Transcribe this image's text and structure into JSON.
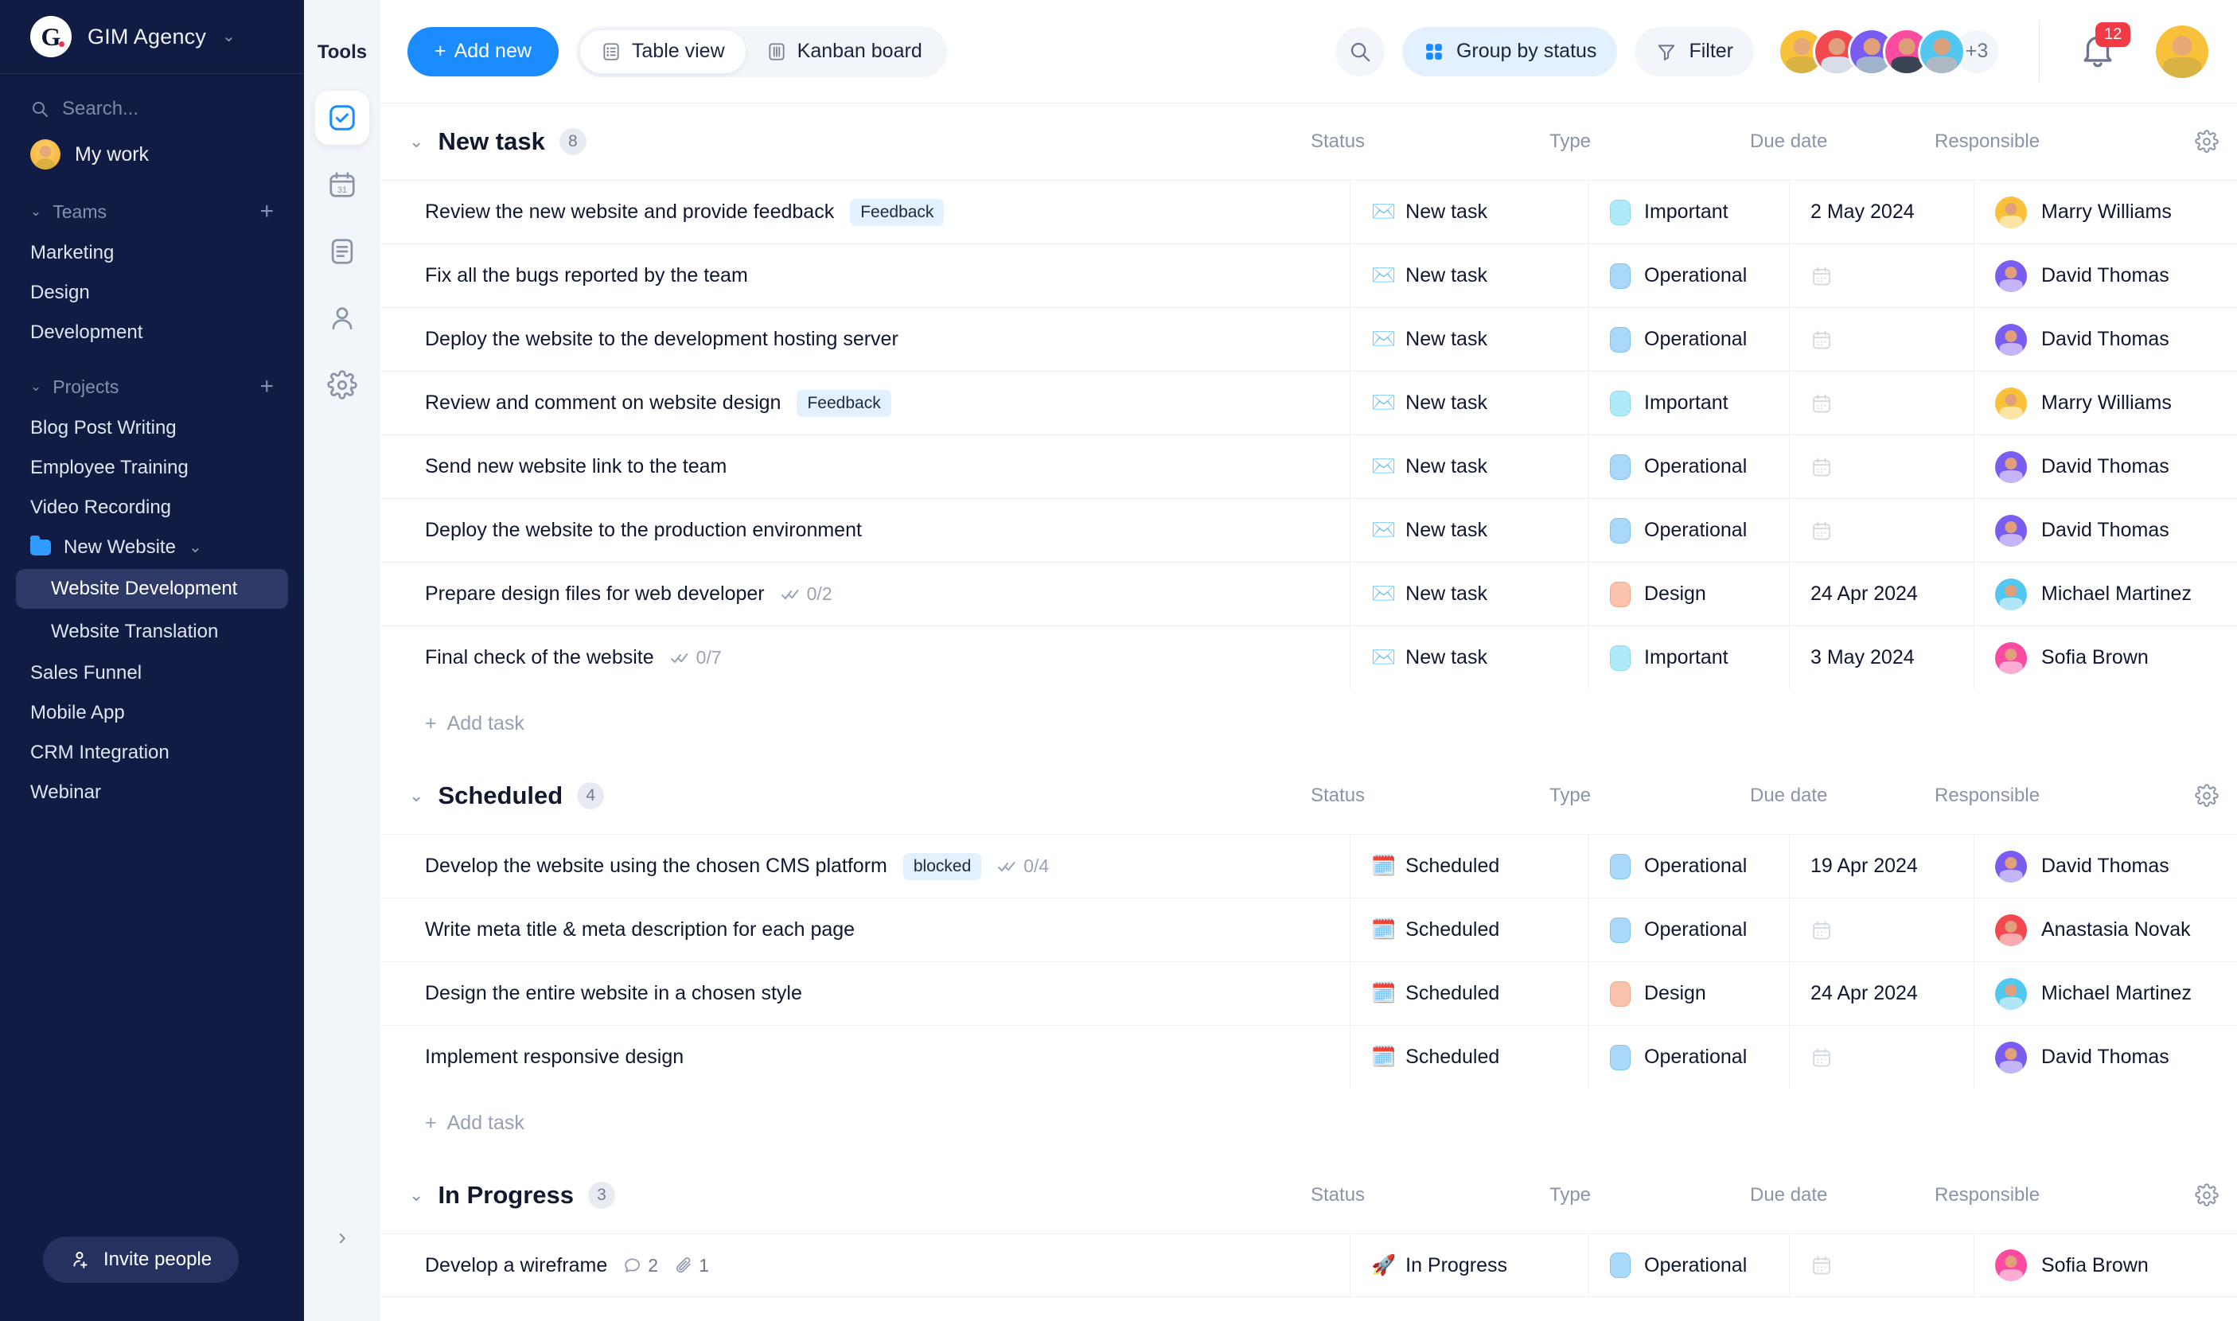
{
  "sidebar": {
    "brand": {
      "logo_letter": "G",
      "name": "GIM Agency",
      "chevron_icon": "chevron-down-icon"
    },
    "search": {
      "placeholder": "Search...",
      "icon": "search-icon"
    },
    "my_work": {
      "label": "My work",
      "avatar": "user-avatar"
    },
    "teams": {
      "label": "Teams",
      "add_label": "+",
      "items": [
        "Marketing",
        "Design",
        "Development"
      ]
    },
    "projects": {
      "label": "Projects",
      "add_label": "+",
      "items": [
        "Blog Post Writing",
        "Employee Training",
        "Video Recording"
      ],
      "folder": {
        "label": "New Website",
        "icon": "folder-icon",
        "chevron_icon": "chevron-down-icon",
        "children": [
          "Website Development",
          "Website Translation"
        ],
        "active_child": "Website Development"
      },
      "items_after": [
        "Sales Funnel",
        "Mobile App",
        "CRM Integration",
        "Webinar"
      ]
    },
    "invite": {
      "label": "Invite people",
      "icon": "user-plus-icon"
    }
  },
  "rail": {
    "title": "Tools",
    "items": [
      {
        "name": "tasks-icon",
        "active": true
      },
      {
        "name": "calendar-icon",
        "active": false
      },
      {
        "name": "document-icon",
        "active": false
      },
      {
        "name": "contacts-icon",
        "active": false
      },
      {
        "name": "settings-icon",
        "active": false
      }
    ],
    "collapse_icon": "chevron-right-icon"
  },
  "topbar": {
    "add_new": "Add new",
    "views": [
      {
        "label": "Table view",
        "icon": "table-icon",
        "active": true
      },
      {
        "label": "Kanban board",
        "icon": "kanban-icon",
        "active": false
      }
    ],
    "search_icon": "search-icon",
    "group_by": {
      "label": "Group by status",
      "icon": "grid-icon"
    },
    "filter": {
      "label": "Filter",
      "icon": "filter-icon"
    },
    "avatars": [
      {
        "name": "Marry Williams",
        "color": "#f9c03a"
      },
      {
        "name": "Anastasia Novak",
        "color": "#f2484f"
      },
      {
        "name": "David Thomas",
        "color": "#7b5cf0"
      },
      {
        "name": "Sofia Brown",
        "color": "#fb4ba0"
      },
      {
        "name": "Michael Martinez",
        "color": "#52c7ef"
      }
    ],
    "avatars_overflow": "+3",
    "notifications": {
      "count": "12",
      "icon": "bell-icon",
      "color": "#f03a45"
    },
    "profile": {
      "name": "Marry Williams",
      "color": "#f9c03a"
    }
  },
  "columns": {
    "task": "",
    "status": "Status",
    "type": "Type",
    "due": "Due date",
    "responsible": "Responsible",
    "gear_icon": "gear-icon"
  },
  "add_task_label": "Add task",
  "groups": [
    {
      "title": "New task",
      "count": "8",
      "caret_icon": "chevron-down-icon",
      "rows": [
        {
          "task": "Review the new website and provide feedback",
          "tag": "Feedback",
          "subtasks": "",
          "status": "New task",
          "status_icon": "✉️",
          "type": "Important",
          "type_class": "t-important",
          "due": "2 May 2024",
          "responsible": "Marry Williams",
          "avatar_color": "#f9c03a"
        },
        {
          "task": "Fix all the bugs reported by the team",
          "tag": "",
          "subtasks": "",
          "status": "New task",
          "status_icon": "✉️",
          "type": "Operational",
          "type_class": "t-operational",
          "due": "",
          "responsible": "David Thomas",
          "avatar_color": "#7b5cf0"
        },
        {
          "task": "Deploy the website to the development hosting server",
          "tag": "",
          "subtasks": "",
          "status": "New task",
          "status_icon": "✉️",
          "type": "Operational",
          "type_class": "t-operational",
          "due": "",
          "responsible": "David Thomas",
          "avatar_color": "#7b5cf0"
        },
        {
          "task": "Review and comment on website design",
          "tag": "Feedback",
          "subtasks": "",
          "status": "New task",
          "status_icon": "✉️",
          "type": "Important",
          "type_class": "t-important",
          "due": "",
          "responsible": "Marry Williams",
          "avatar_color": "#f9c03a"
        },
        {
          "task": "Send new website link to the team",
          "tag": "",
          "subtasks": "",
          "status": "New task",
          "status_icon": "✉️",
          "type": "Operational",
          "type_class": "t-operational",
          "due": "",
          "responsible": "David Thomas",
          "avatar_color": "#7b5cf0"
        },
        {
          "task": "Deploy the website to the production environment",
          "tag": "",
          "subtasks": "",
          "status": "New task",
          "status_icon": "✉️",
          "type": "Operational",
          "type_class": "t-operational",
          "due": "",
          "responsible": "David Thomas",
          "avatar_color": "#7b5cf0"
        },
        {
          "task": "Prepare design files for web developer",
          "tag": "",
          "subtasks": "0/2",
          "status": "New task",
          "status_icon": "✉️",
          "type": "Design",
          "type_class": "t-design",
          "due": "24 Apr 2024",
          "responsible": "Michael Martinez",
          "avatar_color": "#52c7ef"
        },
        {
          "task": "Final check of the website",
          "tag": "",
          "subtasks": "0/7",
          "status": "New task",
          "status_icon": "✉️",
          "type": "Important",
          "type_class": "t-important",
          "due": "3 May 2024",
          "responsible": "Sofia Brown",
          "avatar_color": "#fb4ba0"
        }
      ]
    },
    {
      "title": "Scheduled",
      "count": "4",
      "caret_icon": "chevron-down-icon",
      "rows": [
        {
          "task": "Develop the website using the chosen CMS platform",
          "tag": "blocked",
          "subtasks": "0/4",
          "status": "Scheduled",
          "status_icon": "🗓️",
          "type": "Operational",
          "type_class": "t-operational",
          "due": "19 Apr 2024",
          "responsible": "David Thomas",
          "avatar_color": "#7b5cf0"
        },
        {
          "task": "Write meta title & meta description for each page",
          "tag": "",
          "subtasks": "",
          "status": "Scheduled",
          "status_icon": "🗓️",
          "type": "Operational",
          "type_class": "t-operational",
          "due": "",
          "responsible": "Anastasia Novak",
          "avatar_color": "#f2484f"
        },
        {
          "task": "Design the entire website in a chosen style",
          "tag": "",
          "subtasks": "",
          "status": "Scheduled",
          "status_icon": "🗓️",
          "type": "Design",
          "type_class": "t-design",
          "due": "24 Apr 2024",
          "responsible": "Michael Martinez",
          "avatar_color": "#52c7ef"
        },
        {
          "task": "Implement responsive design",
          "tag": "",
          "subtasks": "",
          "status": "Scheduled",
          "status_icon": "🗓️",
          "type": "Operational",
          "type_class": "t-operational",
          "due": "",
          "responsible": "David Thomas",
          "avatar_color": "#7b5cf0"
        }
      ]
    },
    {
      "title": "In Progress",
      "count": "3",
      "caret_icon": "chevron-down-icon",
      "rows": [
        {
          "task": "Develop a wireframe",
          "tag": "",
          "subtasks": "",
          "comments": "2",
          "attachments": "1",
          "status": "In Progress",
          "status_icon": "🚀",
          "type": "Operational",
          "type_class": "t-operational",
          "due": "",
          "responsible": "Sofia Brown",
          "avatar_color": "#fb4ba0"
        }
      ]
    }
  ]
}
